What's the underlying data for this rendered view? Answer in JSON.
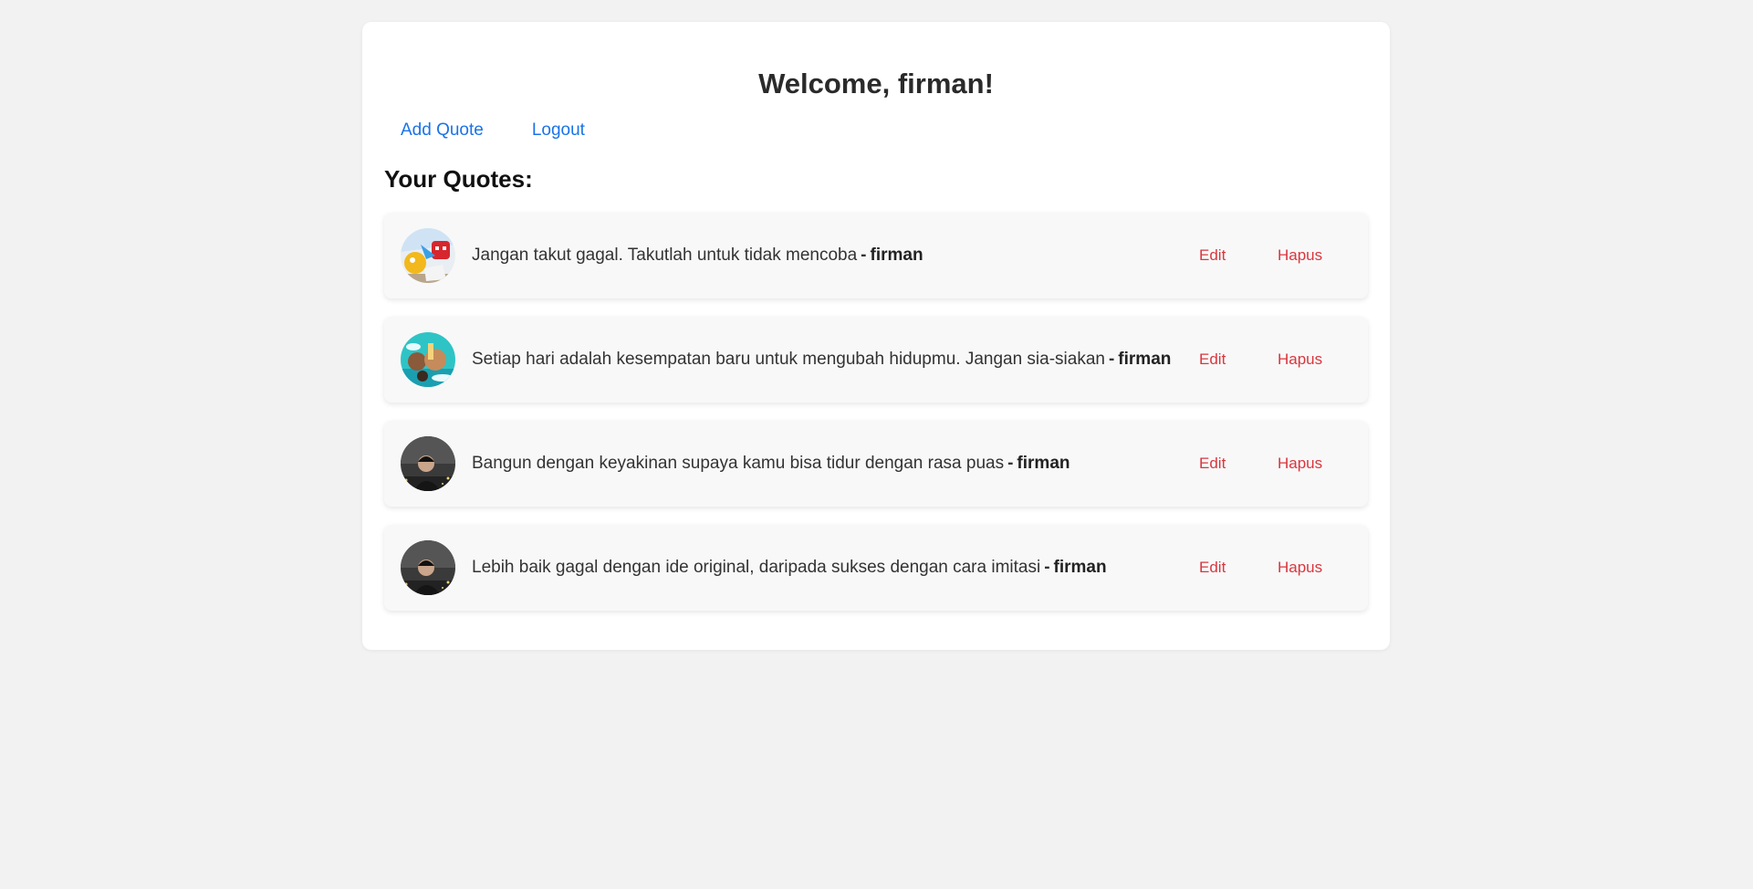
{
  "header": {
    "title": "Welcome, firman!"
  },
  "nav": {
    "add_quote": "Add Quote",
    "logout": "Logout"
  },
  "section": {
    "title": "Your Quotes:"
  },
  "quotes": [
    {
      "text": "Jangan takut gagal. Takutlah untuk tidak mencoba",
      "separator": "-",
      "author": "firman",
      "edit_label": "Edit",
      "delete_label": "Hapus",
      "avatar": "animated-movie-poster"
    },
    {
      "text": "Setiap hari adalah kesempatan baru untuk mengubah hidupmu. Jangan sia-siakan",
      "separator": "-",
      "author": "firman",
      "edit_label": "Edit",
      "delete_label": "Hapus",
      "avatar": "ocean-adventure-poster"
    },
    {
      "text": "Bangun dengan keyakinan supaya kamu bisa tidur dengan rasa puas",
      "separator": "-",
      "author": "firman",
      "edit_label": "Edit",
      "delete_label": "Hapus",
      "avatar": "person-photo"
    },
    {
      "text": "Lebih baik gagal dengan ide original, daripada sukses dengan cara imitasi",
      "separator": "-",
      "author": "firman",
      "edit_label": "Edit",
      "delete_label": "Hapus",
      "avatar": "person-photo"
    }
  ],
  "colors": {
    "page_bg": "#f2f2f2",
    "card_bg": "#ffffff",
    "link": "#1a73e8",
    "action": "#d9363e",
    "item_bg": "#f8f8f8"
  }
}
